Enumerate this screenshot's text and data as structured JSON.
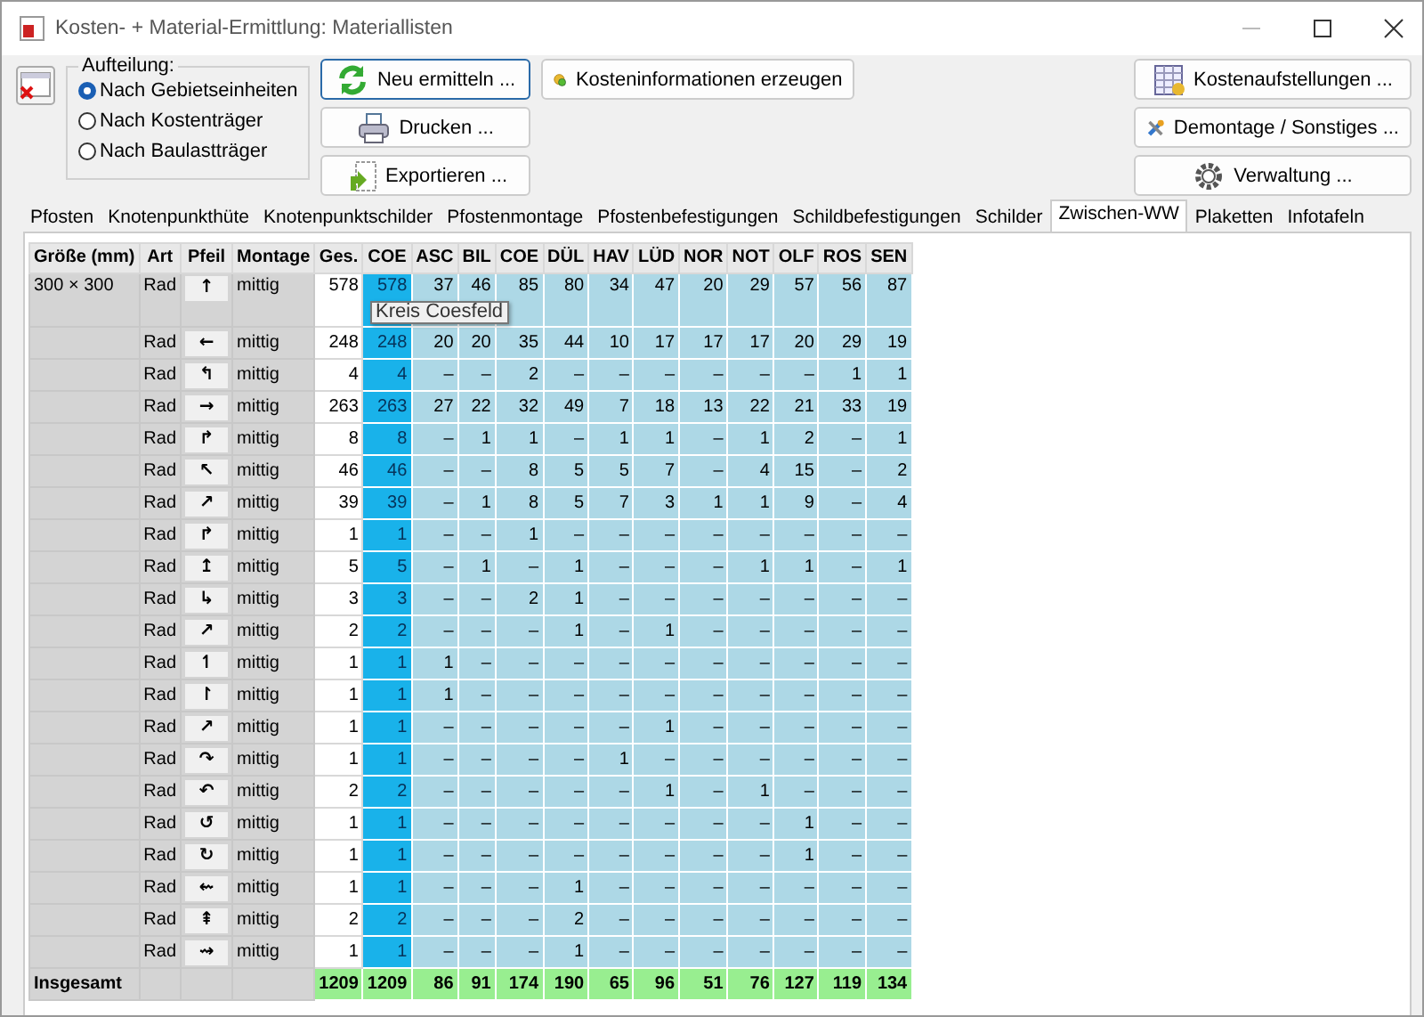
{
  "window": {
    "title": "Kosten- + Material-Ermittlung: Materiallisten"
  },
  "aufteilung": {
    "label": "Aufteilung:",
    "options": [
      {
        "label": "Nach Gebietseinheiten",
        "selected": true
      },
      {
        "label": "Nach Kostenträger",
        "selected": false
      },
      {
        "label": "Nach Baulastträger",
        "selected": false
      }
    ]
  },
  "middle_buttons": [
    {
      "label": "Neu ermitteln ...",
      "kind": "refresh"
    },
    {
      "label": "Drucken ...",
      "kind": "print"
    },
    {
      "label": "Exportieren ...",
      "kind": "export"
    }
  ],
  "info_button": {
    "label": "Kosteninformationen erzeugen",
    "kind": "coins"
  },
  "right_buttons": [
    {
      "label": "Kostenaufstellungen ...",
      "kind": "sheet"
    },
    {
      "label": "Demontage / Sonstiges ...",
      "kind": "tools"
    },
    {
      "label": "Verwaltung ...",
      "kind": "gear"
    }
  ],
  "tabs": [
    {
      "label": "Pfosten",
      "selected": false
    },
    {
      "label": "Knotenpunkthüte",
      "selected": false
    },
    {
      "label": "Knotenpunktschilder",
      "selected": false
    },
    {
      "label": "Pfostenmontage",
      "selected": false
    },
    {
      "label": "Pfostenbefestigungen",
      "selected": false
    },
    {
      "label": "Schildbefestigungen",
      "selected": false
    },
    {
      "label": "Schilder",
      "selected": false
    },
    {
      "label": "Zwischen-WW",
      "selected": true
    },
    {
      "label": "Plaketten",
      "selected": false
    },
    {
      "label": "Infotafeln",
      "selected": false
    }
  ],
  "table": {
    "columns": [
      "Größe (mm)",
      "Art",
      "Pfeil",
      "Montage"
    ],
    "value_columns": [
      {
        "label": "Ges.",
        "kind": "sum"
      },
      {
        "label": "COE",
        "kind": "highlight"
      },
      {
        "label": "ASC",
        "kind": "region"
      },
      {
        "label": "BIL",
        "kind": "region"
      },
      {
        "label": "COE",
        "kind": "region"
      },
      {
        "label": "DÜL",
        "kind": "region"
      },
      {
        "label": "HAV",
        "kind": "region"
      },
      {
        "label": "LÜD",
        "kind": "region"
      },
      {
        "label": "NOR",
        "kind": "region"
      },
      {
        "label": "NOT",
        "kind": "region"
      },
      {
        "label": "OLF",
        "kind": "region"
      },
      {
        "label": "ROS",
        "kind": "region"
      },
      {
        "label": "SEN",
        "kind": "region"
      }
    ],
    "rows": [
      {
        "size": "300 × 300",
        "art": "Rad",
        "pfeil": "↑",
        "montage": "mittig",
        "values": [
          "578",
          "578",
          "37",
          "46",
          "85",
          "80",
          "34",
          "47",
          "20",
          "29",
          "57",
          "56",
          "87"
        ]
      },
      {
        "art": "Rad",
        "pfeil": "←",
        "montage": "mittig",
        "values": [
          "248",
          "248",
          "20",
          "20",
          "35",
          "44",
          "10",
          "17",
          "17",
          "17",
          "20",
          "29",
          "19"
        ]
      },
      {
        "art": "Rad",
        "pfeil": "↰",
        "montage": "mittig",
        "values": [
          "4",
          "4",
          "–",
          "–",
          "2",
          "–",
          "–",
          "–",
          "–",
          "–",
          "–",
          "1",
          "1"
        ]
      },
      {
        "art": "Rad",
        "pfeil": "→",
        "montage": "mittig",
        "values": [
          "263",
          "263",
          "27",
          "22",
          "32",
          "49",
          "7",
          "18",
          "13",
          "22",
          "21",
          "33",
          "19"
        ]
      },
      {
        "art": "Rad",
        "pfeil": "↱",
        "montage": "mittig",
        "values": [
          "8",
          "8",
          "–",
          "1",
          "1",
          "–",
          "1",
          "1",
          "–",
          "1",
          "2",
          "–",
          "1"
        ]
      },
      {
        "art": "Rad",
        "pfeil": "↖",
        "montage": "mittig",
        "values": [
          "46",
          "46",
          "–",
          "–",
          "8",
          "5",
          "5",
          "7",
          "–",
          "4",
          "15",
          "–",
          "2"
        ]
      },
      {
        "art": "Rad",
        "pfeil": "↗",
        "montage": "mittig",
        "values": [
          "39",
          "39",
          "–",
          "1",
          "8",
          "5",
          "7",
          "3",
          "1",
          "1",
          "9",
          "–",
          "4"
        ]
      },
      {
        "art": "Rad",
        "pfeil": "↱",
        "montage": "mittig",
        "values": [
          "1",
          "1",
          "–",
          "–",
          "1",
          "–",
          "–",
          "–",
          "–",
          "–",
          "–",
          "–",
          "–"
        ]
      },
      {
        "art": "Rad",
        "pfeil": "↥",
        "montage": "mittig",
        "values": [
          "5",
          "5",
          "–",
          "1",
          "–",
          "1",
          "–",
          "–",
          "–",
          "1",
          "1",
          "–",
          "1"
        ]
      },
      {
        "art": "Rad",
        "pfeil": "↳",
        "montage": "mittig",
        "values": [
          "3",
          "3",
          "–",
          "–",
          "2",
          "1",
          "–",
          "–",
          "–",
          "–",
          "–",
          "–",
          "–"
        ]
      },
      {
        "art": "Rad",
        "pfeil": "↗",
        "montage": "mittig",
        "values": [
          "2",
          "2",
          "–",
          "–",
          "–",
          "1",
          "–",
          "1",
          "–",
          "–",
          "–",
          "–",
          "–"
        ]
      },
      {
        "art": "Rad",
        "pfeil": "↿",
        "montage": "mittig",
        "values": [
          "1",
          "1",
          "1",
          "–",
          "–",
          "–",
          "–",
          "–",
          "–",
          "–",
          "–",
          "–",
          "–"
        ]
      },
      {
        "art": "Rad",
        "pfeil": "↾",
        "montage": "mittig",
        "values": [
          "1",
          "1",
          "1",
          "–",
          "–",
          "–",
          "–",
          "–",
          "–",
          "–",
          "–",
          "–",
          "–"
        ]
      },
      {
        "art": "Rad",
        "pfeil": "↗",
        "montage": "mittig",
        "values": [
          "1",
          "1",
          "–",
          "–",
          "–",
          "–",
          "–",
          "1",
          "–",
          "–",
          "–",
          "–",
          "–"
        ]
      },
      {
        "art": "Rad",
        "pfeil": "↷",
        "montage": "mittig",
        "values": [
          "1",
          "1",
          "–",
          "–",
          "–",
          "–",
          "1",
          "–",
          "–",
          "–",
          "–",
          "–",
          "–"
        ]
      },
      {
        "art": "Rad",
        "pfeil": "↶",
        "montage": "mittig",
        "values": [
          "2",
          "2",
          "–",
          "–",
          "–",
          "–",
          "–",
          "1",
          "–",
          "1",
          "–",
          "–",
          "–"
        ]
      },
      {
        "art": "Rad",
        "pfeil": "↺",
        "montage": "mittig",
        "values": [
          "1",
          "1",
          "–",
          "–",
          "–",
          "–",
          "–",
          "–",
          "–",
          "–",
          "1",
          "–",
          "–"
        ]
      },
      {
        "art": "Rad",
        "pfeil": "↻",
        "montage": "mittig",
        "values": [
          "1",
          "1",
          "–",
          "–",
          "–",
          "–",
          "–",
          "–",
          "–",
          "–",
          "1",
          "–",
          "–"
        ]
      },
      {
        "art": "Rad",
        "pfeil": "⇜",
        "montage": "mittig",
        "values": [
          "1",
          "1",
          "–",
          "–",
          "–",
          "1",
          "–",
          "–",
          "–",
          "–",
          "–",
          "–",
          "–"
        ]
      },
      {
        "art": "Rad",
        "pfeil": "⇞",
        "montage": "mittig",
        "values": [
          "2",
          "2",
          "–",
          "–",
          "–",
          "2",
          "–",
          "–",
          "–",
          "–",
          "–",
          "–",
          "–"
        ]
      },
      {
        "art": "Rad",
        "pfeil": "⇝",
        "montage": "mittig",
        "values": [
          "1",
          "1",
          "–",
          "–",
          "–",
          "1",
          "–",
          "–",
          "–",
          "–",
          "–",
          "–",
          "–"
        ]
      }
    ],
    "total": {
      "label": "Insgesamt",
      "values": [
        "1209",
        "1209",
        "86",
        "91",
        "174",
        "190",
        "65",
        "96",
        "51",
        "76",
        "127",
        "119",
        "134"
      ]
    }
  },
  "tooltip": {
    "text": "Kreis Coesfeld"
  }
}
